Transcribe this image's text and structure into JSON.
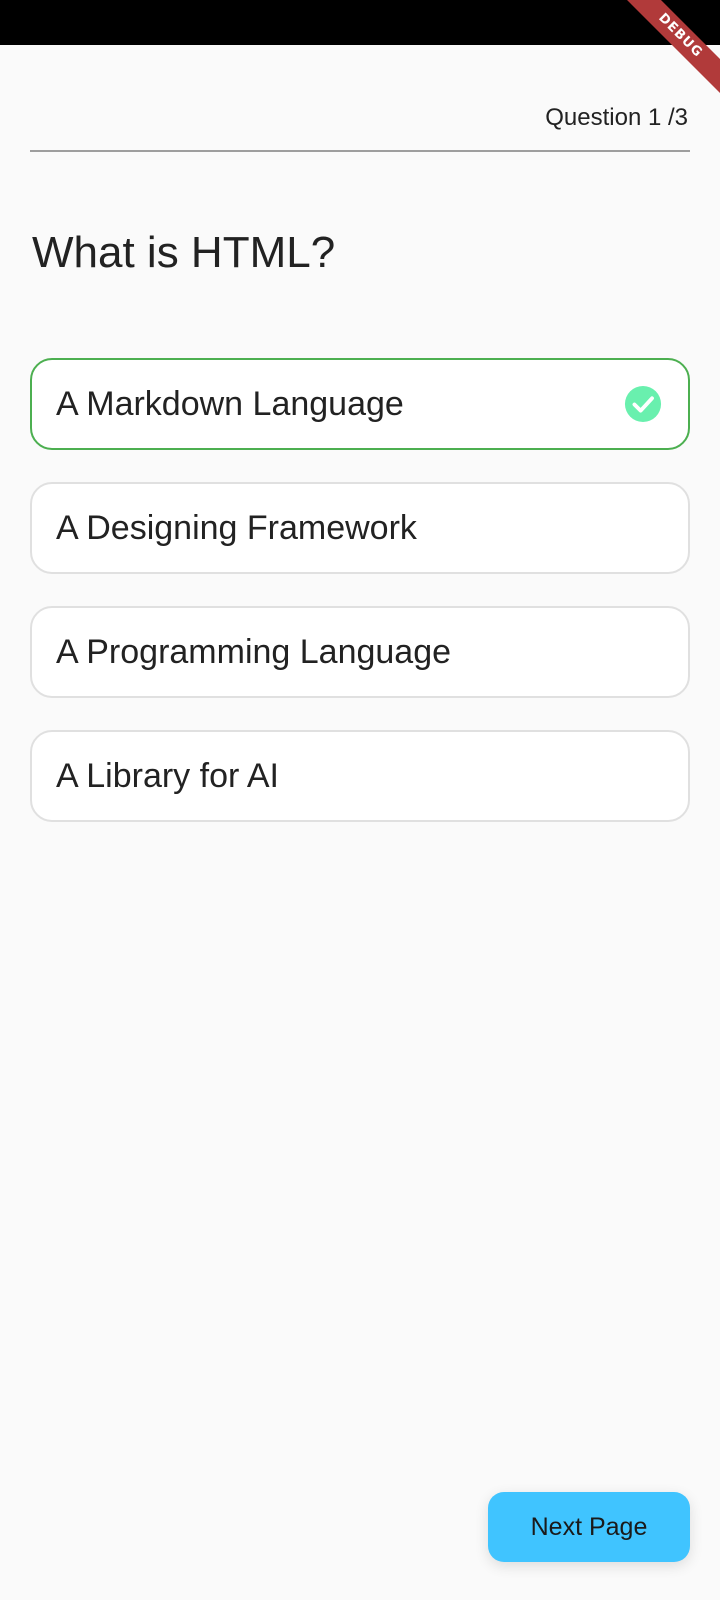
{
  "header": {
    "progress_label": "Question 1 /3",
    "debug_label": "DEBUG"
  },
  "question": {
    "title": "What is HTML?"
  },
  "options": [
    {
      "label": "A Markdown Language",
      "selected": true
    },
    {
      "label": "A Designing Framework",
      "selected": false
    },
    {
      "label": "A Programming Language",
      "selected": false
    },
    {
      "label": "A Library for AI",
      "selected": false
    }
  ],
  "footer": {
    "next_label": "Next Page"
  },
  "colors": {
    "selected_border": "#4caf50",
    "check_icon": "#69f0ae",
    "next_button": "#40c4ff",
    "debug_ribbon": "#b13a3a"
  },
  "icons": {
    "selected_option": "check-circle-icon"
  }
}
